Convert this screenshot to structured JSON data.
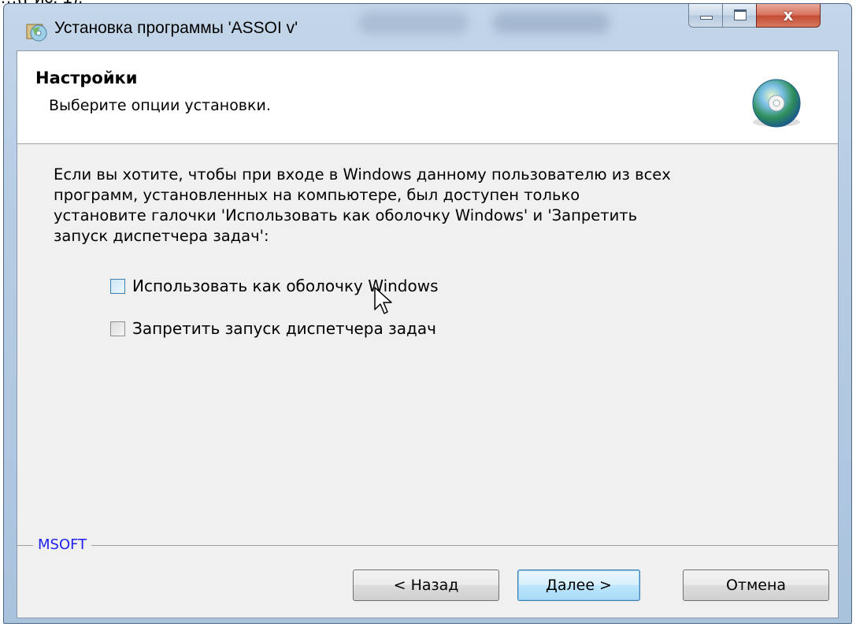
{
  "page_caption_fragment": "…(Рис. 1).",
  "window": {
    "title": "Установка программы 'ASSOI v'",
    "close_glyph": "x"
  },
  "header": {
    "title": "Настройки",
    "subtitle": "Выберите опции установки."
  },
  "intro_lines": [
    "Если вы хотите, чтобы при входе в Windows данному пользователю из всех",
    "программ, установленных на компьютере, был доступен только",
    "установите галочки 'Использовать как оболочку Windows' и  'Запретить",
    "запуск диспетчера задач':"
  ],
  "options": [
    {
      "label": "Использовать как оболочку Windows",
      "checked": false
    },
    {
      "label": "Запретить запуск диспетчера задач",
      "checked": false
    }
  ],
  "brand": "MSOFT",
  "buttons": {
    "back": "< Назад",
    "next": "Далее >",
    "cancel": "Отмена"
  },
  "icons": {
    "app": "installer-disc-icon",
    "header": "cd-disc-icon",
    "cursor": "mouse-pointer-icon"
  },
  "colors": {
    "brand_text": "#2020ee",
    "default_button_border": "#3c7fb1",
    "close_button": "#c24b33"
  }
}
